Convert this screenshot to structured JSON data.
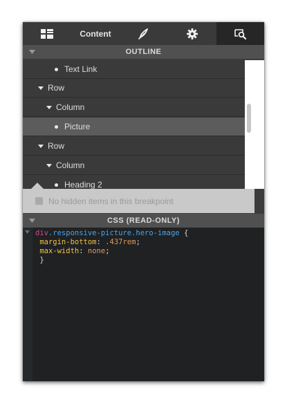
{
  "toolbar": {
    "content_label": "Content"
  },
  "outline": {
    "header": "OUTLINE",
    "items": [
      {
        "label": "Text Link",
        "kind": "bullet"
      },
      {
        "label": "Row",
        "kind": "caret"
      },
      {
        "label": "Column",
        "kind": "caret"
      },
      {
        "label": "Picture",
        "kind": "bullet",
        "selected": true
      },
      {
        "label": "Row",
        "kind": "caret"
      },
      {
        "label": "Column",
        "kind": "caret"
      },
      {
        "label": "Heading 2",
        "kind": "bullet"
      }
    ],
    "hidden_notice": "No hidden items in this breakpoint"
  },
  "css": {
    "header": "CSS (READ-ONLY)",
    "selector_tag": "div",
    "selector_class": ".responsive-picture.hero-image",
    "open_brace": " {",
    "rules": [
      {
        "property": "margin-bottom",
        "value": ".437rem"
      },
      {
        "property": "max-width",
        "value": "none"
      }
    ],
    "close_brace": "}"
  },
  "colors": {
    "panel_bg": "#3c3c3c",
    "selected_row": "#5c5c5c",
    "editor_bg": "#1f2123",
    "tag": "#d14a8a",
    "selector": "#4aa3e8",
    "property": "#f0c248",
    "value": "#e09a5a"
  },
  "icons": [
    "layout-grid-icon",
    "brush-icon",
    "gear-icon",
    "inspect-icon",
    "caret-down-icon",
    "bullet-icon",
    "fold-arrow-icon"
  ]
}
